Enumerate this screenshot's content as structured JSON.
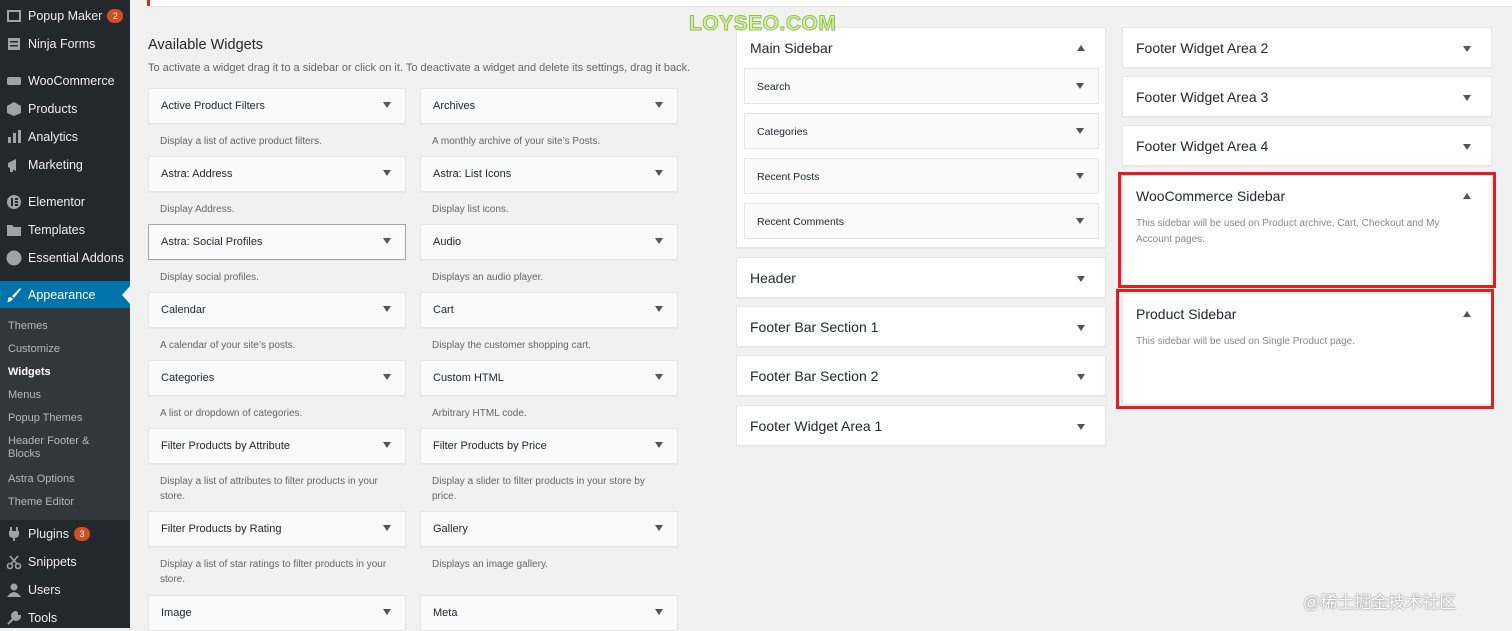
{
  "admin_menu": {
    "items_top": [
      {
        "label": "Popup Maker",
        "icon": "popup-icon",
        "badge": "2"
      },
      {
        "label": "Ninja Forms",
        "icon": "forms-icon"
      }
    ],
    "items_mid": [
      {
        "label": "WooCommerce",
        "icon": "woo-icon"
      },
      {
        "label": "Products",
        "icon": "box-icon"
      },
      {
        "label": "Analytics",
        "icon": "bar-chart-icon"
      },
      {
        "label": "Marketing",
        "icon": "megaphone-icon"
      },
      {
        "label": "Elementor",
        "icon": "elementor-icon"
      },
      {
        "label": "Templates",
        "icon": "folder-icon"
      },
      {
        "label": "Essential Addons",
        "icon": "ea-icon",
        "icon_text": "EA"
      }
    ],
    "appearance": {
      "label": "Appearance",
      "icon": "brush-icon"
    },
    "submenu": [
      "Themes",
      "Customize",
      "Widgets",
      "Menus",
      "Popup Themes",
      "Header Footer & Blocks",
      "Astra Options",
      "Theme Editor"
    ],
    "items_bottom": [
      {
        "label": "Plugins",
        "icon": "plug-icon",
        "badge": "3"
      },
      {
        "label": "Snippets",
        "icon": "scissors-icon"
      },
      {
        "label": "Users",
        "icon": "user-icon"
      },
      {
        "label": "Tools",
        "icon": "wrench-icon"
      }
    ],
    "colors": {
      "bg": "#23282d",
      "submenu_bg": "#32373c",
      "current": "#0073aa",
      "badge": "#d54e21"
    }
  },
  "available_widgets": {
    "title": "Available Widgets",
    "description": "To activate a widget drag it to a sidebar or click on it. To deactivate a widget and delete its settings, drag it back.",
    "widgets": [
      {
        "title": "Active Product Filters",
        "desc": "Display a list of active product filters."
      },
      {
        "title": "Archives",
        "desc": "A monthly archive of your site’s Posts."
      },
      {
        "title": "Astra: Address",
        "desc": "Display Address."
      },
      {
        "title": "Astra: List Icons",
        "desc": "Display list icons."
      },
      {
        "title": "Astra: Social Profiles",
        "desc": "Display social profiles."
      },
      {
        "title": "Audio",
        "desc": "Displays an audio player."
      },
      {
        "title": "Calendar",
        "desc": "A calendar of your site’s posts."
      },
      {
        "title": "Cart",
        "desc": "Display the customer shopping cart."
      },
      {
        "title": "Categories",
        "desc": "A list or dropdown of categories."
      },
      {
        "title": "Custom HTML",
        "desc": "Arbitrary HTML code."
      },
      {
        "title": "Filter Products by Attribute",
        "desc": "Display a list of attributes to filter products in your store."
      },
      {
        "title": "Filter Products by Price",
        "desc": "Display a slider to filter products in your store by price."
      },
      {
        "title": "Filter Products by Rating",
        "desc": "Display a list of star ratings to filter products in your store."
      },
      {
        "title": "Gallery",
        "desc": "Displays an image gallery."
      },
      {
        "title": "Image",
        "desc": ""
      },
      {
        "title": "Meta",
        "desc": ""
      }
    ]
  },
  "main_sidebar": {
    "title": "Main Sidebar",
    "widgets": [
      "Search",
      "Categories",
      "Recent Posts",
      "Recent Comments"
    ]
  },
  "sidebars_col2": [
    "Header",
    "Footer Bar Section 1",
    "Footer Bar Section 2",
    "Footer Widget Area 1"
  ],
  "sidebars_col3": [
    "Footer Widget Area 2",
    "Footer Widget Area 3",
    "Footer Widget Area 4"
  ],
  "woocommerce_sidebar": {
    "title": "WooCommerce Sidebar",
    "desc": "This sidebar will be used on Product archive, Cart, Checkout and My Account pages."
  },
  "product_sidebar": {
    "title": "Product Sidebar",
    "desc": "This sidebar will be used on Single Product page."
  },
  "watermarks": {
    "top": "LOYSEO.COM",
    "bottom": "@稀土掘金技术社区"
  },
  "colors": {
    "highlight": "#e02020",
    "page_bg": "#f1f1f1"
  }
}
